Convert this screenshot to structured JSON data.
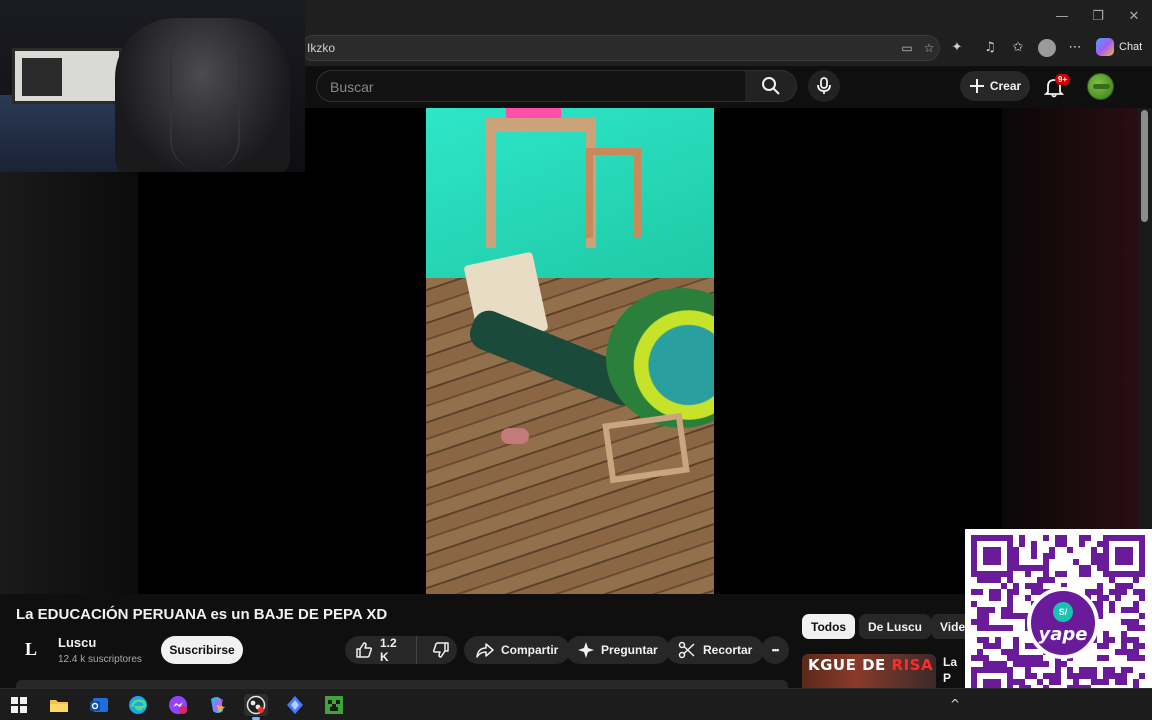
{
  "browser": {
    "address_text": "Ikzko",
    "chat_label": "Chat",
    "minimize": "—",
    "restore": "❐",
    "close": "✕"
  },
  "youtube_header": {
    "search_placeholder": "Buscar",
    "create_label": "Crear",
    "notifications_badge": "9+"
  },
  "video": {
    "title": "La EDUCACIÓN PERUANA es un BAJE DE PEPA XD",
    "channel_initial": "L",
    "channel_name": "Luscu",
    "subscribers": "12.4 k suscriptores",
    "subscribe_label": "Suscribirse",
    "likes": "1.2 K",
    "share_label": "Compartir",
    "ask_label": "Preguntar",
    "clip_label": "Recortar",
    "more_label": "•••"
  },
  "sidebar": {
    "chips": [
      "Todos",
      "De Luscu",
      "Vide"
    ],
    "active_chip": "Todos",
    "recommendation": {
      "thumb_text_white": "KGUE DE ",
      "thumb_text_red": "RISA",
      "title": "La P BAJ"
    }
  },
  "overlay": {
    "qr_brand": "yape",
    "qr_badge_symbol": "S/"
  },
  "taskbar": {
    "apps": [
      "start-icon",
      "file-explorer-icon",
      "outlook-icon",
      "edge-icon",
      "messenger-icon",
      "copilot-icon",
      "obs-icon",
      "vscode-like-icon",
      "minecraft-icon"
    ],
    "tray_chevron": "^"
  },
  "colors": {
    "background": "#0f0f0f",
    "yape_purple": "#6a1b9a",
    "notification_red": "#cc0000"
  }
}
